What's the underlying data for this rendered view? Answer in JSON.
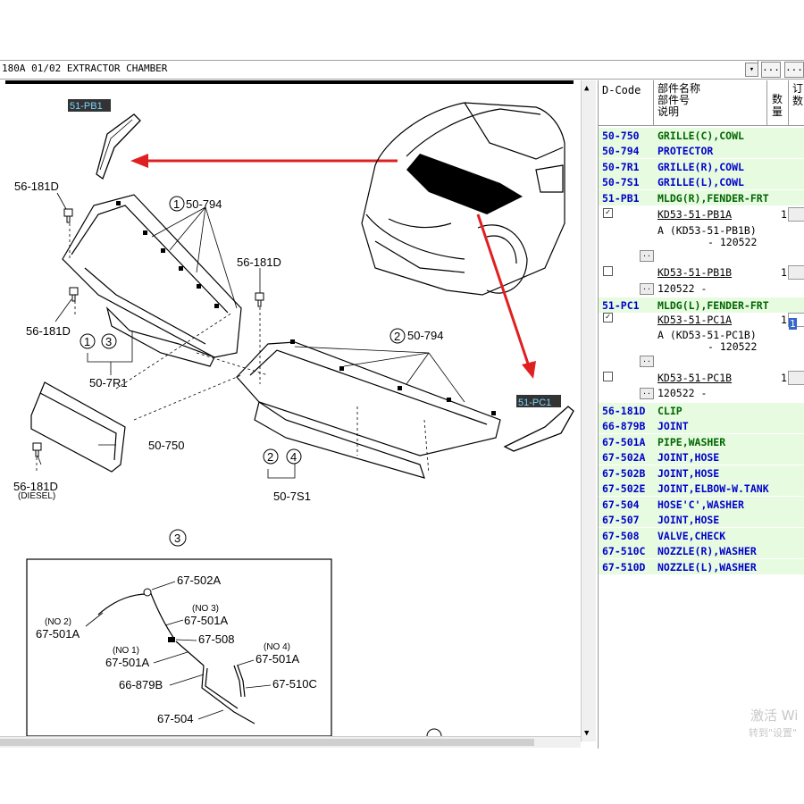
{
  "window": {
    "title": "180A 01/02 EXTRACTOR CHAMBER",
    "dropdown_icon": "chevron-down",
    "more_label": "..."
  },
  "diagram": {
    "callouts": {
      "pb1": "51-PB1",
      "pc1": "51-PC1",
      "clip_top_left": "56-181D",
      "clip_mid_left": "56-181D",
      "clip_center": "56-181D",
      "clip_diesel": "56-181D",
      "diesel_note": "(DIESEL)",
      "n1": "1",
      "n2": "2",
      "n3": "3",
      "n4": "4",
      "n1b": "1",
      "n2b": "2",
      "p50_794_a": "50-794",
      "p50_794_b": "50-794",
      "p50_7r1": "50-7R1",
      "p50_750": "50-750",
      "p50_7s1": "50-7S1",
      "inset_num": "3"
    },
    "inset": {
      "p67_502a": "67-502A",
      "no2": "(NO 2)",
      "p67_501a_1": "67-501A",
      "no3": "(NO 3)",
      "p67_501a_2": "67-501A",
      "p67_508": "67-508",
      "no1": "(NO 1)",
      "p67_501a_3": "67-501A",
      "no4": "(NO 4)",
      "p67_501a_4": "67-501A",
      "p66_879b": "66-879B",
      "p67_510c": "67-510C",
      "p67_504": "67-504"
    }
  },
  "table": {
    "headers": {
      "code": "D-Code",
      "name": "部件名称\n部件号\n说明",
      "qty": "数量",
      "col4": "订数"
    },
    "rows": [
      {
        "code": "50-750",
        "name": "GRILLE(C),COWL",
        "color": "green"
      },
      {
        "code": "50-794",
        "name": "PROTECTOR",
        "color": "blue"
      },
      {
        "code": "50-7R1",
        "name": "GRILLE(R),COWL",
        "color": "blue"
      },
      {
        "code": "50-7S1",
        "name": "GRILLE(L),COWL",
        "color": "blue"
      },
      {
        "code": "51-PB1",
        "name": "MLDG(R),FENDER-FRT",
        "color": "green"
      }
    ],
    "pb1_parts": [
      {
        "checked": true,
        "part": "KD53-51-PB1A",
        "desc": "A (KD53-51-PB1B)",
        "date": "- 120522",
        "qty": "1"
      },
      {
        "checked": false,
        "part": "KD53-51-PB1B",
        "desc": "120522 -",
        "qty": "1"
      }
    ],
    "pc1_row": {
      "code": "51-PC1",
      "name": "MLDG(L),FENDER-FRT",
      "color": "green"
    },
    "pc1_parts": [
      {
        "checked": true,
        "part": "KD53-51-PC1A",
        "desc": "A (KD53-51-PC1B)",
        "date": "- 120522",
        "qty": "1",
        "input": "1"
      },
      {
        "checked": false,
        "part": "KD53-51-PC1B",
        "desc": "120522 -",
        "qty": "1"
      }
    ],
    "rows_after": [
      {
        "code": "56-181D",
        "name": "CLIP",
        "color": "green"
      },
      {
        "code": "66-879B",
        "name": "JOINT",
        "color": "blue"
      },
      {
        "code": "67-501A",
        "name": "PIPE,WASHER",
        "color": "green"
      },
      {
        "code": "67-502A",
        "name": "JOINT,HOSE",
        "color": "blue"
      },
      {
        "code": "67-502B",
        "name": "JOINT,HOSE",
        "color": "blue"
      },
      {
        "code": "67-502E",
        "name": "JOINT,ELBOW-W.TANK",
        "color": "blue"
      },
      {
        "code": "67-504",
        "name": "HOSE'C',WASHER",
        "color": "blue"
      },
      {
        "code": "67-507",
        "name": "JOINT,HOSE",
        "color": "blue"
      },
      {
        "code": "67-508",
        "name": "VALVE,CHECK",
        "color": "blue"
      },
      {
        "code": "67-510C",
        "name": "NOZZLE(R),WASHER",
        "color": "blue"
      },
      {
        "code": "67-510D",
        "name": "NOZZLE(L),WASHER",
        "color": "blue"
      }
    ]
  },
  "watermark": {
    "line1": "激活 Wi",
    "line2": "转到\"设置\""
  },
  "colors": {
    "accent_red": "#e02020",
    "row_green": "#e6fbe0",
    "code_blue": "#0000cc",
    "code_green": "#006600"
  }
}
